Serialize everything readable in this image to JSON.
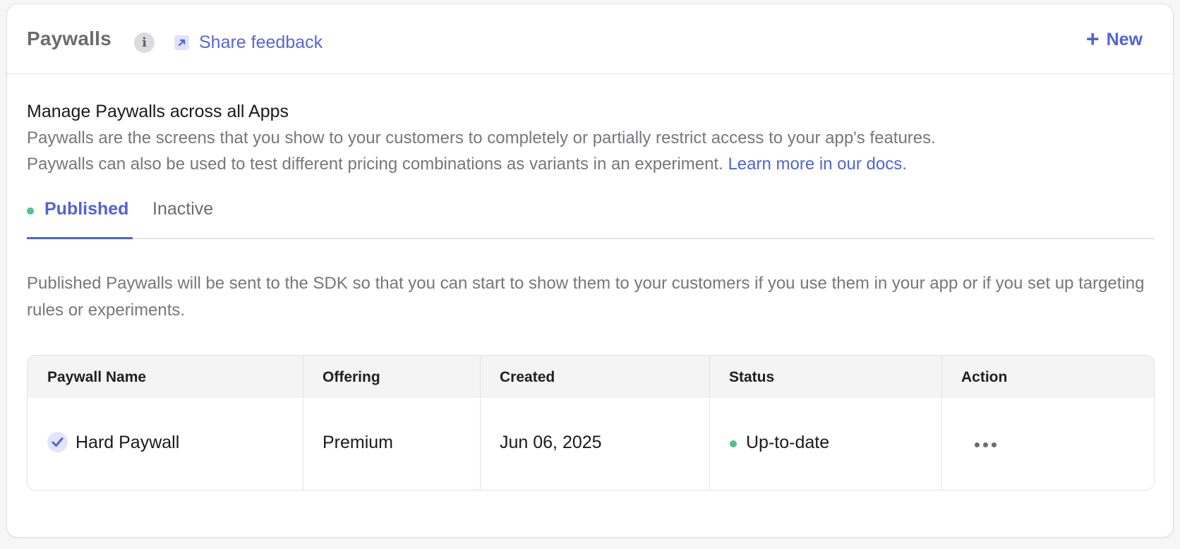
{
  "header": {
    "title": "Paywalls",
    "info_icon": "info-icon",
    "feedback_label": "Share feedback",
    "new_label": "New"
  },
  "intro": {
    "title": "Manage Paywalls across all Apps",
    "line1": "Paywalls are the screens that you show to your customers to completely or partially restrict access to your app's features.",
    "line2": "Paywalls can also be used to test different pricing combinations as variants in an experiment.",
    "docs_link": "Learn more in our docs."
  },
  "tabs": [
    {
      "label": "Published",
      "active": true
    },
    {
      "label": "Inactive",
      "active": false
    }
  ],
  "tab_description": "Published Paywalls will be sent to the SDK so that you can start to show them to your customers if you use them in your app or if you set up targeting rules or experiments.",
  "table": {
    "columns": [
      "Paywall Name",
      "Offering",
      "Created",
      "Status",
      "Action"
    ],
    "rows": [
      {
        "name": "Hard Paywall",
        "offering": "Premium",
        "created": "Jun 06, 2025",
        "status": "Up-to-date"
      }
    ]
  },
  "colors": {
    "accent": "#4f63d8",
    "status_green": "#4cc38a",
    "muted_text": "#77777b"
  }
}
